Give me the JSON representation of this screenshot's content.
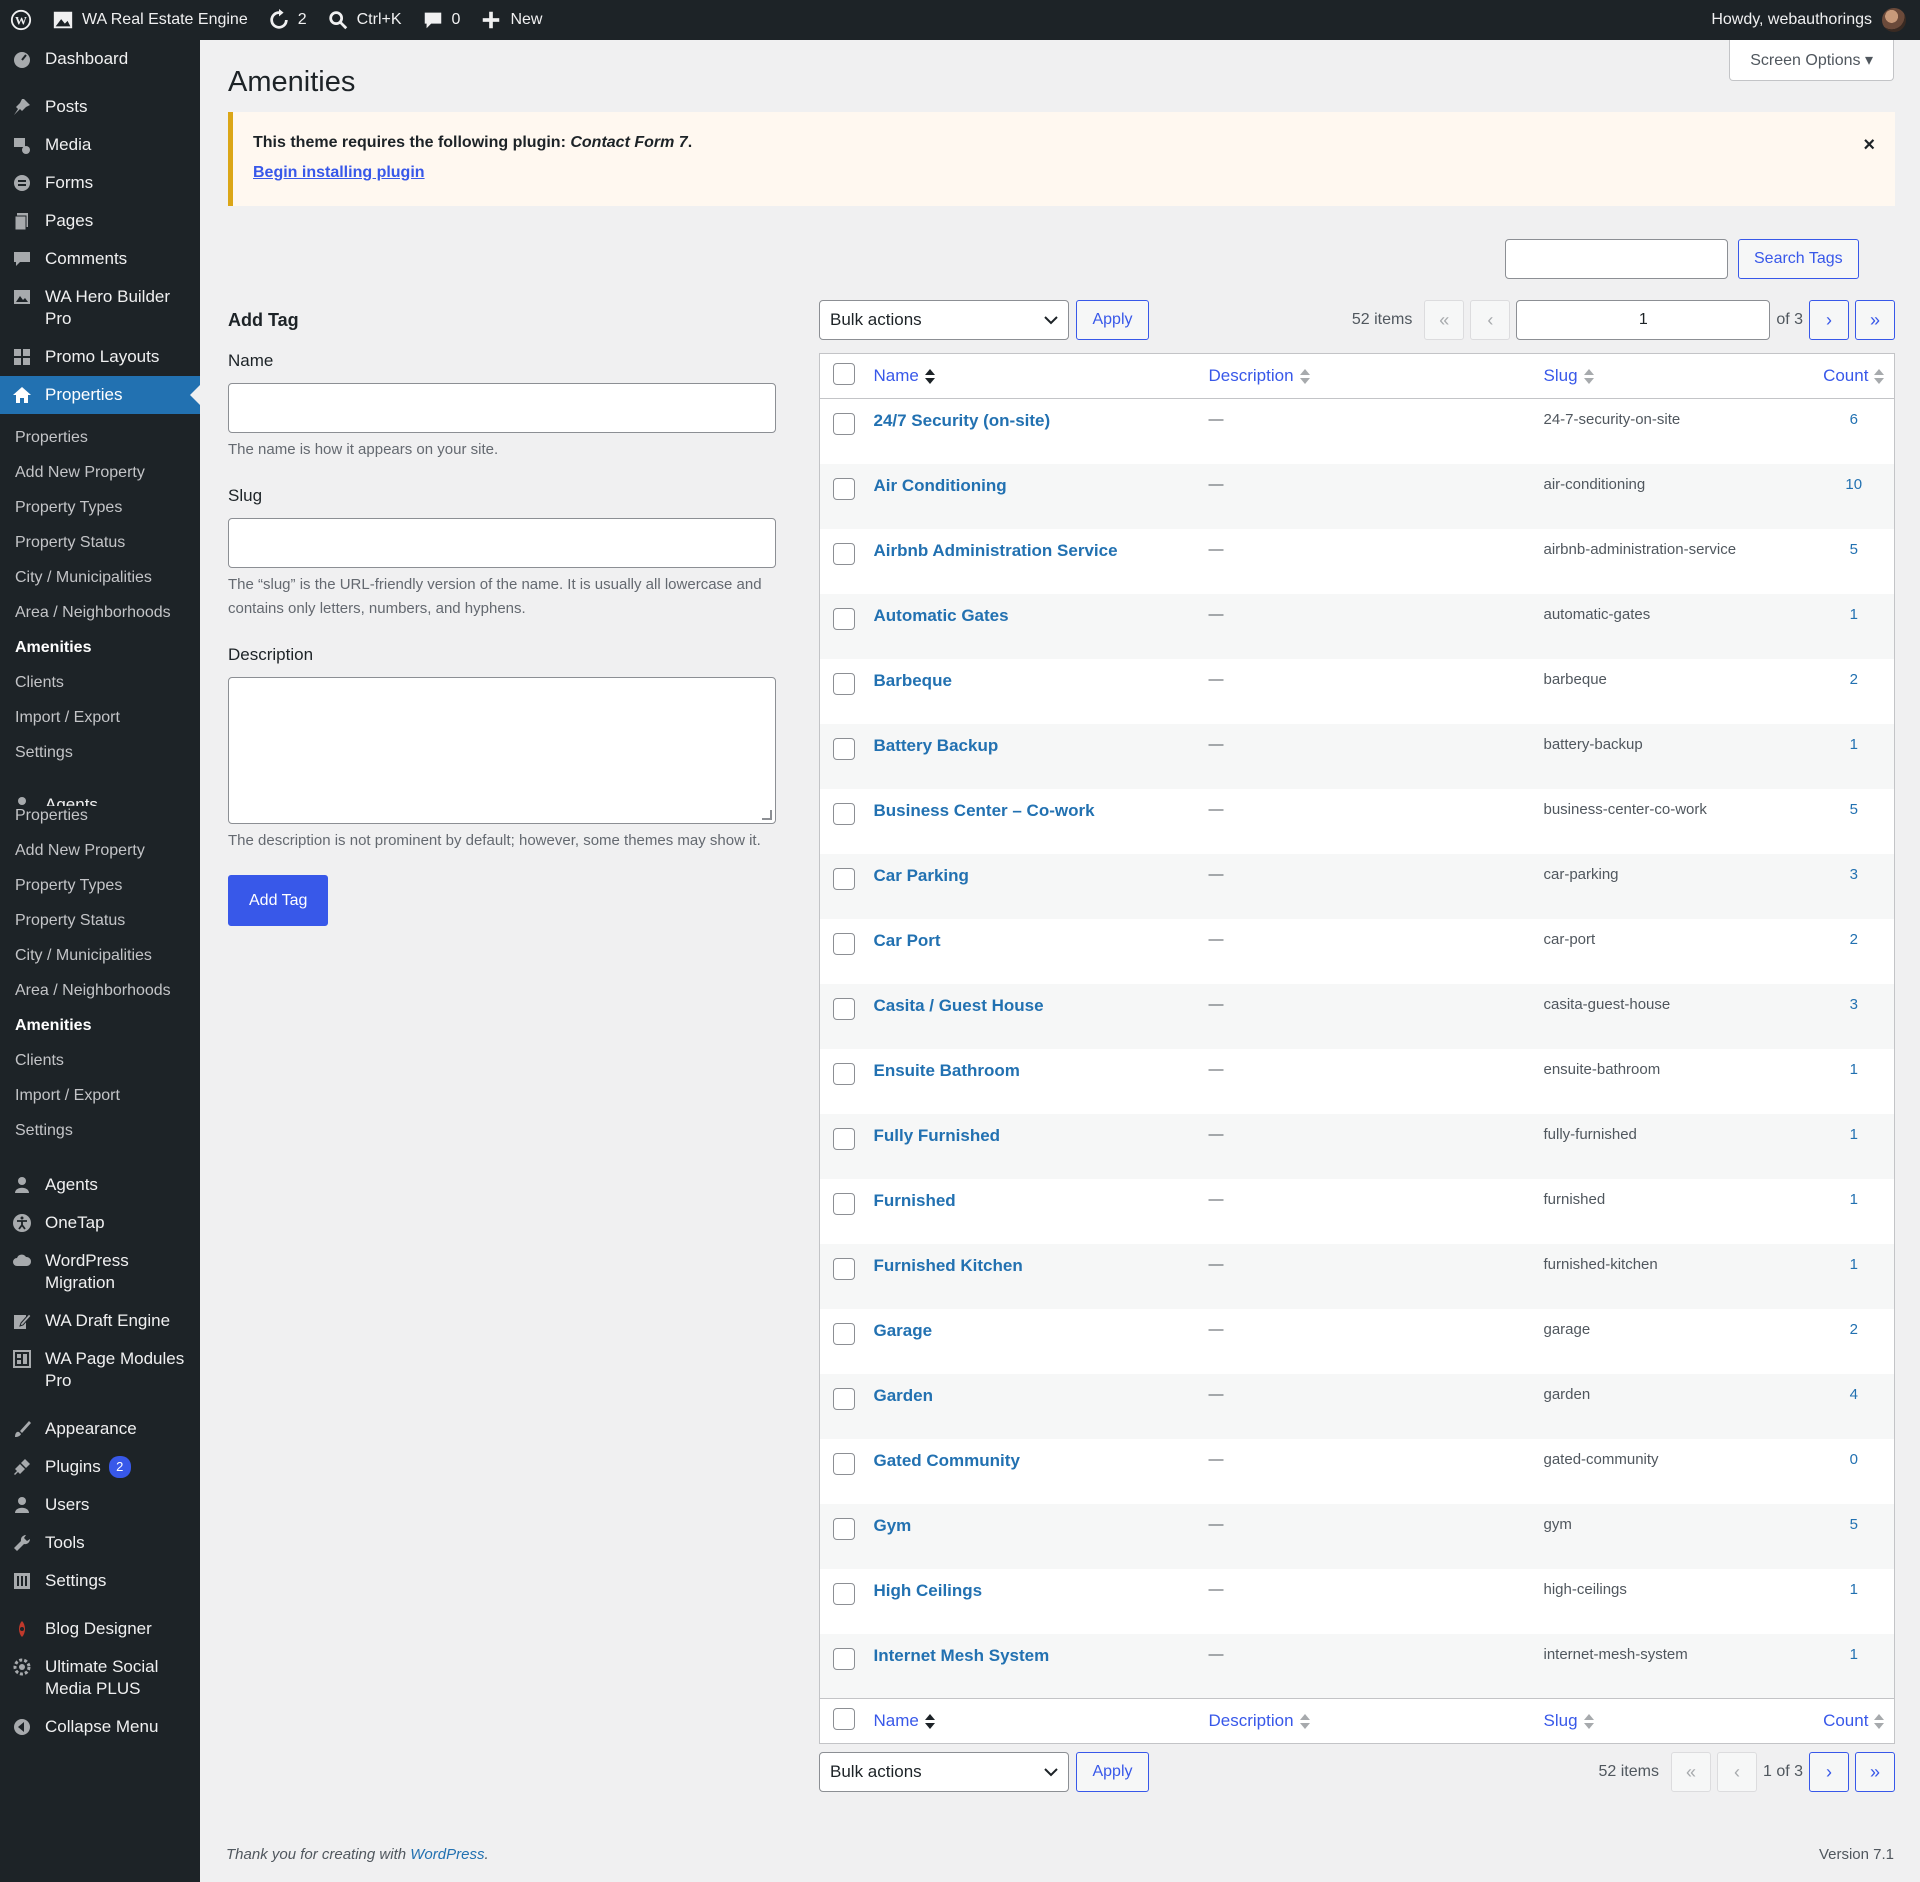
{
  "adminbar": {
    "site_name": "WA Real Estate Engine",
    "updates_count": "2",
    "search_shortcut": "Ctrl+K",
    "comments_count": "0",
    "new_label": "New",
    "howdy": "Howdy, webauthorings"
  },
  "sidebar": {
    "top_items": [
      {
        "label": "Dashboard",
        "icon": "dashboard-icon"
      }
    ],
    "items_a": [
      {
        "label": "Posts",
        "icon": "pin-icon"
      },
      {
        "label": "Media",
        "icon": "media-icon"
      },
      {
        "label": "Forms",
        "icon": "forms-icon"
      },
      {
        "label": "Pages",
        "icon": "pages-icon"
      },
      {
        "label": "Comments",
        "icon": "comment-icon"
      },
      {
        "label": "WA Hero Builder Pro",
        "icon": "image-icon"
      },
      {
        "label": "Promo Layouts",
        "icon": "grid-icon"
      }
    ],
    "active_item": {
      "label": "Properties",
      "icon": "home-icon"
    },
    "submenu": [
      "Properties",
      "Add New Property",
      "Property Types",
      "Property Status",
      "City / Municipalities",
      "Area / Neighborhoods",
      "Amenities",
      "Clients",
      "Import / Export",
      "Settings"
    ],
    "flyout_partial": "Agents",
    "flyout_submenu": [
      "Properties",
      "Add New Property",
      "Property Types",
      "Property Status",
      "City / Municipalities",
      "Area / Neighborhoods",
      "Amenities",
      "Clients",
      "Import / Export",
      "Settings"
    ],
    "current_sub": "Amenities",
    "items_b": [
      {
        "label": "Agents",
        "icon": "person-icon"
      },
      {
        "label": "OneTap",
        "icon": "accessibility-icon"
      },
      {
        "label": "WordPress Migration",
        "icon": "cloud-icon"
      },
      {
        "label": "WA Draft Engine",
        "icon": "edit-icon"
      },
      {
        "label": "WA Page Modules Pro",
        "icon": "modules-icon"
      }
    ],
    "items_c": [
      {
        "label": "Appearance",
        "icon": "brush-icon"
      },
      {
        "label": "Plugins",
        "icon": "plugin-icon",
        "badge": "2"
      },
      {
        "label": "Users",
        "icon": "users-icon"
      },
      {
        "label": "Tools",
        "icon": "wrench-icon"
      },
      {
        "label": "Settings",
        "icon": "settings-icon"
      }
    ],
    "items_d": [
      {
        "label": "Blog Designer",
        "icon": "blog-designer-icon"
      },
      {
        "label": "Ultimate Social Media PLUS",
        "icon": "social-icon"
      },
      {
        "label": "Collapse Menu",
        "icon": "collapse-icon"
      }
    ]
  },
  "screen_options": "Screen Options ▾",
  "page_title": "Amenities",
  "notice": {
    "text_prefix": "This theme requires the following plugin: ",
    "plugin": "Contact Form 7",
    "text_suffix": ".",
    "link": "Begin installing plugin",
    "dismiss": "×"
  },
  "search": {
    "button": "Search Tags"
  },
  "form": {
    "heading": "Add Tag",
    "name_label": "Name",
    "name_help": "The name is how it appears on your site.",
    "slug_label": "Slug",
    "slug_help": "The “slug” is the URL-friendly version of the name. It is usually all lowercase and contains only letters, numbers, and hyphens.",
    "desc_label": "Description",
    "desc_help": "The description is not prominent by default; however, some themes may show it.",
    "submit": "Add Tag"
  },
  "tablenav": {
    "bulk": "Bulk actions",
    "apply": "Apply",
    "items": "52 items",
    "page": "1",
    "of": "of 3",
    "bottom_page": "1 of 3",
    "first": "«",
    "prev": "‹",
    "next": "›",
    "last": "»"
  },
  "columns": {
    "name": "Name",
    "description": "Description",
    "slug": "Slug",
    "count": "Count"
  },
  "rows": [
    {
      "name": "24/7 Security (on-site)",
      "desc": "—",
      "slug": "24-7-security-on-site",
      "count": "6"
    },
    {
      "name": "Air Conditioning",
      "desc": "—",
      "slug": "air-conditioning",
      "count": "10"
    },
    {
      "name": "Airbnb Administration Service",
      "desc": "—",
      "slug": "airbnb-administration-service",
      "count": "5"
    },
    {
      "name": "Automatic Gates",
      "desc": "—",
      "slug": "automatic-gates",
      "count": "1"
    },
    {
      "name": "Barbeque",
      "desc": "—",
      "slug": "barbeque",
      "count": "2"
    },
    {
      "name": "Battery Backup",
      "desc": "—",
      "slug": "battery-backup",
      "count": "1"
    },
    {
      "name": "Business Center – Co-work",
      "desc": "—",
      "slug": "business-center-co-work",
      "count": "5"
    },
    {
      "name": "Car Parking",
      "desc": "—",
      "slug": "car-parking",
      "count": "3"
    },
    {
      "name": "Car Port",
      "desc": "—",
      "slug": "car-port",
      "count": "2"
    },
    {
      "name": "Casita / Guest House",
      "desc": "—",
      "slug": "casita-guest-house",
      "count": "3"
    },
    {
      "name": "Ensuite Bathroom",
      "desc": "—",
      "slug": "ensuite-bathroom",
      "count": "1"
    },
    {
      "name": "Fully Furnished",
      "desc": "—",
      "slug": "fully-furnished",
      "count": "1"
    },
    {
      "name": "Furnished",
      "desc": "—",
      "slug": "furnished",
      "count": "1"
    },
    {
      "name": "Furnished Kitchen",
      "desc": "—",
      "slug": "furnished-kitchen",
      "count": "1"
    },
    {
      "name": "Garage",
      "desc": "—",
      "slug": "garage",
      "count": "2"
    },
    {
      "name": "Garden",
      "desc": "—",
      "slug": "garden",
      "count": "4"
    },
    {
      "name": "Gated Community",
      "desc": "—",
      "slug": "gated-community",
      "count": "0"
    },
    {
      "name": "Gym",
      "desc": "—",
      "slug": "gym",
      "count": "5"
    },
    {
      "name": "High Ceilings",
      "desc": "—",
      "slug": "high-ceilings",
      "count": "1"
    },
    {
      "name": "Internet Mesh System",
      "desc": "—",
      "slug": "internet-mesh-system",
      "count": "1"
    }
  ],
  "footer": {
    "thanks": "Thank you for creating with ",
    "link": "WordPress",
    "dot": ".",
    "version": "Version 7.1"
  }
}
